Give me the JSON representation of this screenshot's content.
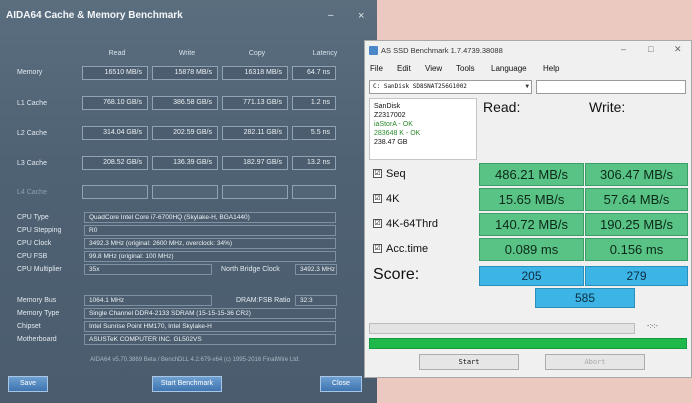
{
  "aida": {
    "title": "AIDA64 Cache & Memory Benchmark",
    "min_glyph": "–",
    "close_glyph": "×",
    "columns": [
      "Read",
      "Write",
      "Copy",
      "Latency"
    ],
    "rows": [
      {
        "label": "Memory",
        "values": [
          "16510 MB/s",
          "15878 MB/s",
          "16318 MB/s",
          "64.7 ns"
        ]
      },
      {
        "label": "L1 Cache",
        "values": [
          "768.10 GB/s",
          "386.58 GB/s",
          "771.13 GB/s",
          "1.2 ns"
        ]
      },
      {
        "label": "L2 Cache",
        "values": [
          "314.04 GB/s",
          "202.59 GB/s",
          "282.11 GB/s",
          "5.5 ns"
        ]
      },
      {
        "label": "L3 Cache",
        "values": [
          "208.52 GB/s",
          "136.39 GB/s",
          "182.97 GB/s",
          "13.2 ns"
        ]
      },
      {
        "label": "L4 Cache",
        "values": [
          "",
          "",
          "",
          ""
        ]
      }
    ],
    "cpu": {
      "type_label": "CPU Type",
      "type_value": "QuadCore Intel Core i7-6700HQ (Skylake-H, BGA1440)",
      "stepping_label": "CPU Stepping",
      "stepping_value": "R0",
      "clock_label": "CPU Clock",
      "clock_value": "3492.3 MHz (original: 2600 MHz, overclock: 34%)",
      "fsb_label": "CPU FSB",
      "fsb_value": "99.8 MHz (original: 100 MHz)",
      "mult_label": "CPU Multiplier",
      "mult_value": "35x",
      "nb_label": "North Bridge Clock",
      "nb_value": "3492.3 MHz"
    },
    "mem": {
      "bus_label": "Memory Bus",
      "bus_value": "1064.1 MHz",
      "ratio_label": "DRAM:FSB Ratio",
      "ratio_value": "32:3",
      "type_label": "Memory Type",
      "type_value": "Single Channel DDR4-2133 SDRAM (15-15-15-36 CR2)",
      "chipset_label": "Chipset",
      "chipset_value": "Intel Sunrise Point HM170, Intel Skylake-H",
      "mb_label": "Motherboard",
      "mb_value": "ASUSTeK COMPUTER INC. GL502VS"
    },
    "footer": "AIDA64 v5.70.3869 Beta / BenchDLL 4.2.679-x64  (c) 1995-2016 FinalWire Ltd.",
    "buttons": {
      "save": "Save",
      "start": "Start Benchmark",
      "close": "Close"
    }
  },
  "asssd": {
    "title": "AS SSD Benchmark 1.7.4739.38088",
    "ctl_min": "–",
    "ctl_max": "□",
    "ctl_close": "✕",
    "menu": [
      "File",
      "Edit",
      "View",
      "Tools",
      "Language",
      "Help"
    ],
    "drive": "C: SanDisk SD8SNAT256G1002",
    "info": {
      "vendor": "SanDisk",
      "model": "Z2317002",
      "driver": "iaStorA - OK",
      "align": "283648 K - OK",
      "size": "238.47 GB"
    },
    "read_header": "Read:",
    "write_header": "Write:",
    "tests": [
      {
        "label": "Seq",
        "read": "486.21 MB/s",
        "write": "306.47 MB/s"
      },
      {
        "label": "4K",
        "read": "15.65 MB/s",
        "write": "57.64 MB/s"
      },
      {
        "label": "4K-64Thrd",
        "read": "140.72 MB/s",
        "write": "190.25 MB/s"
      },
      {
        "label": "Acc.time",
        "read": "0.089 ms",
        "write": "0.156 ms"
      }
    ],
    "score_label": "Score:",
    "score_read": "205",
    "score_write": "279",
    "score_total": "585",
    "progress_time": "-:-:-",
    "buttons": {
      "start": "Start",
      "abort": "Abort"
    },
    "check_glyph": "☑"
  }
}
